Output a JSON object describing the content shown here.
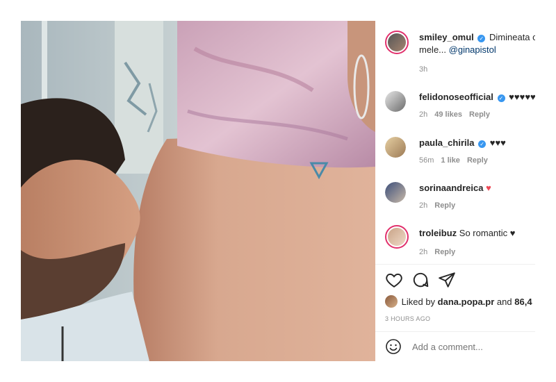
{
  "post": {
    "author": "smiley_omul",
    "caption": "Dimineata cu",
    "caption_cont": "mele...",
    "mention": "@ginapistol",
    "time": "3h"
  },
  "comments": [
    {
      "user": "felidonoseofficial",
      "verified": true,
      "text": "♥♥♥♥♥",
      "time": "2h",
      "likes": "49 likes",
      "reply": "Reply"
    },
    {
      "user": "paula_chirila",
      "verified": true,
      "text": "♥♥♥",
      "time": "56m",
      "likes": "1 like",
      "reply": "Reply"
    },
    {
      "user": "sorinaandreica",
      "verified": false,
      "text": "♥",
      "time": "2h",
      "reply": "Reply"
    },
    {
      "user": "troleibuz",
      "verified": false,
      "text": "So romantic ♥",
      "time": "2h",
      "reply": "Reply"
    }
  ],
  "likes": {
    "prefix": "Liked by",
    "user": "dana.popa.pr",
    "and": "and",
    "count": "86,4"
  },
  "timestamp": "3 HOURS AGO",
  "add_comment": {
    "placeholder": "Add a comment..."
  },
  "colors": {
    "verified": "#3897f0",
    "link": "#00376b",
    "muted": "#8e8e8e",
    "heart": "#ed4956"
  }
}
